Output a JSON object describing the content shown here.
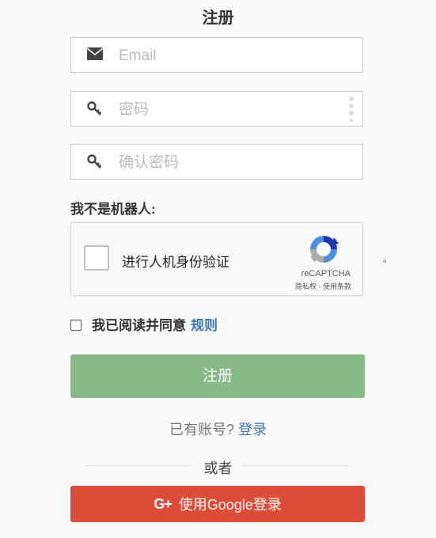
{
  "form": {
    "title": "注册",
    "email_placeholder": "Email",
    "password_placeholder": "密码",
    "confirm_password_placeholder": "确认密码",
    "robot_label": "我不是机器人:",
    "agree_text": "我已阅读并同意",
    "rules_link": "规则",
    "register_button": "注册",
    "have_account_text": "已有账号?",
    "login_link": "登录",
    "or_text": "或者",
    "google_button": "使用Google登录",
    "google_icon_text": "G+"
  },
  "recaptcha": {
    "checkbox_label": "进行人机身份验证",
    "brand": "reCAPTCHA",
    "terms": "隐私权 - 使用条款"
  },
  "side_mark": "。",
  "colors": {
    "register_button": "#84ba86",
    "google_button": "#dd4b39",
    "link": "#3f77b2"
  },
  "icons": {
    "email": "envelope-icon",
    "password": "key-icon",
    "confirm_password": "key-icon",
    "password_manager": "dots-icon",
    "recaptcha_logo": "recaptcha-logo-icon",
    "google": "google-plus-icon"
  }
}
